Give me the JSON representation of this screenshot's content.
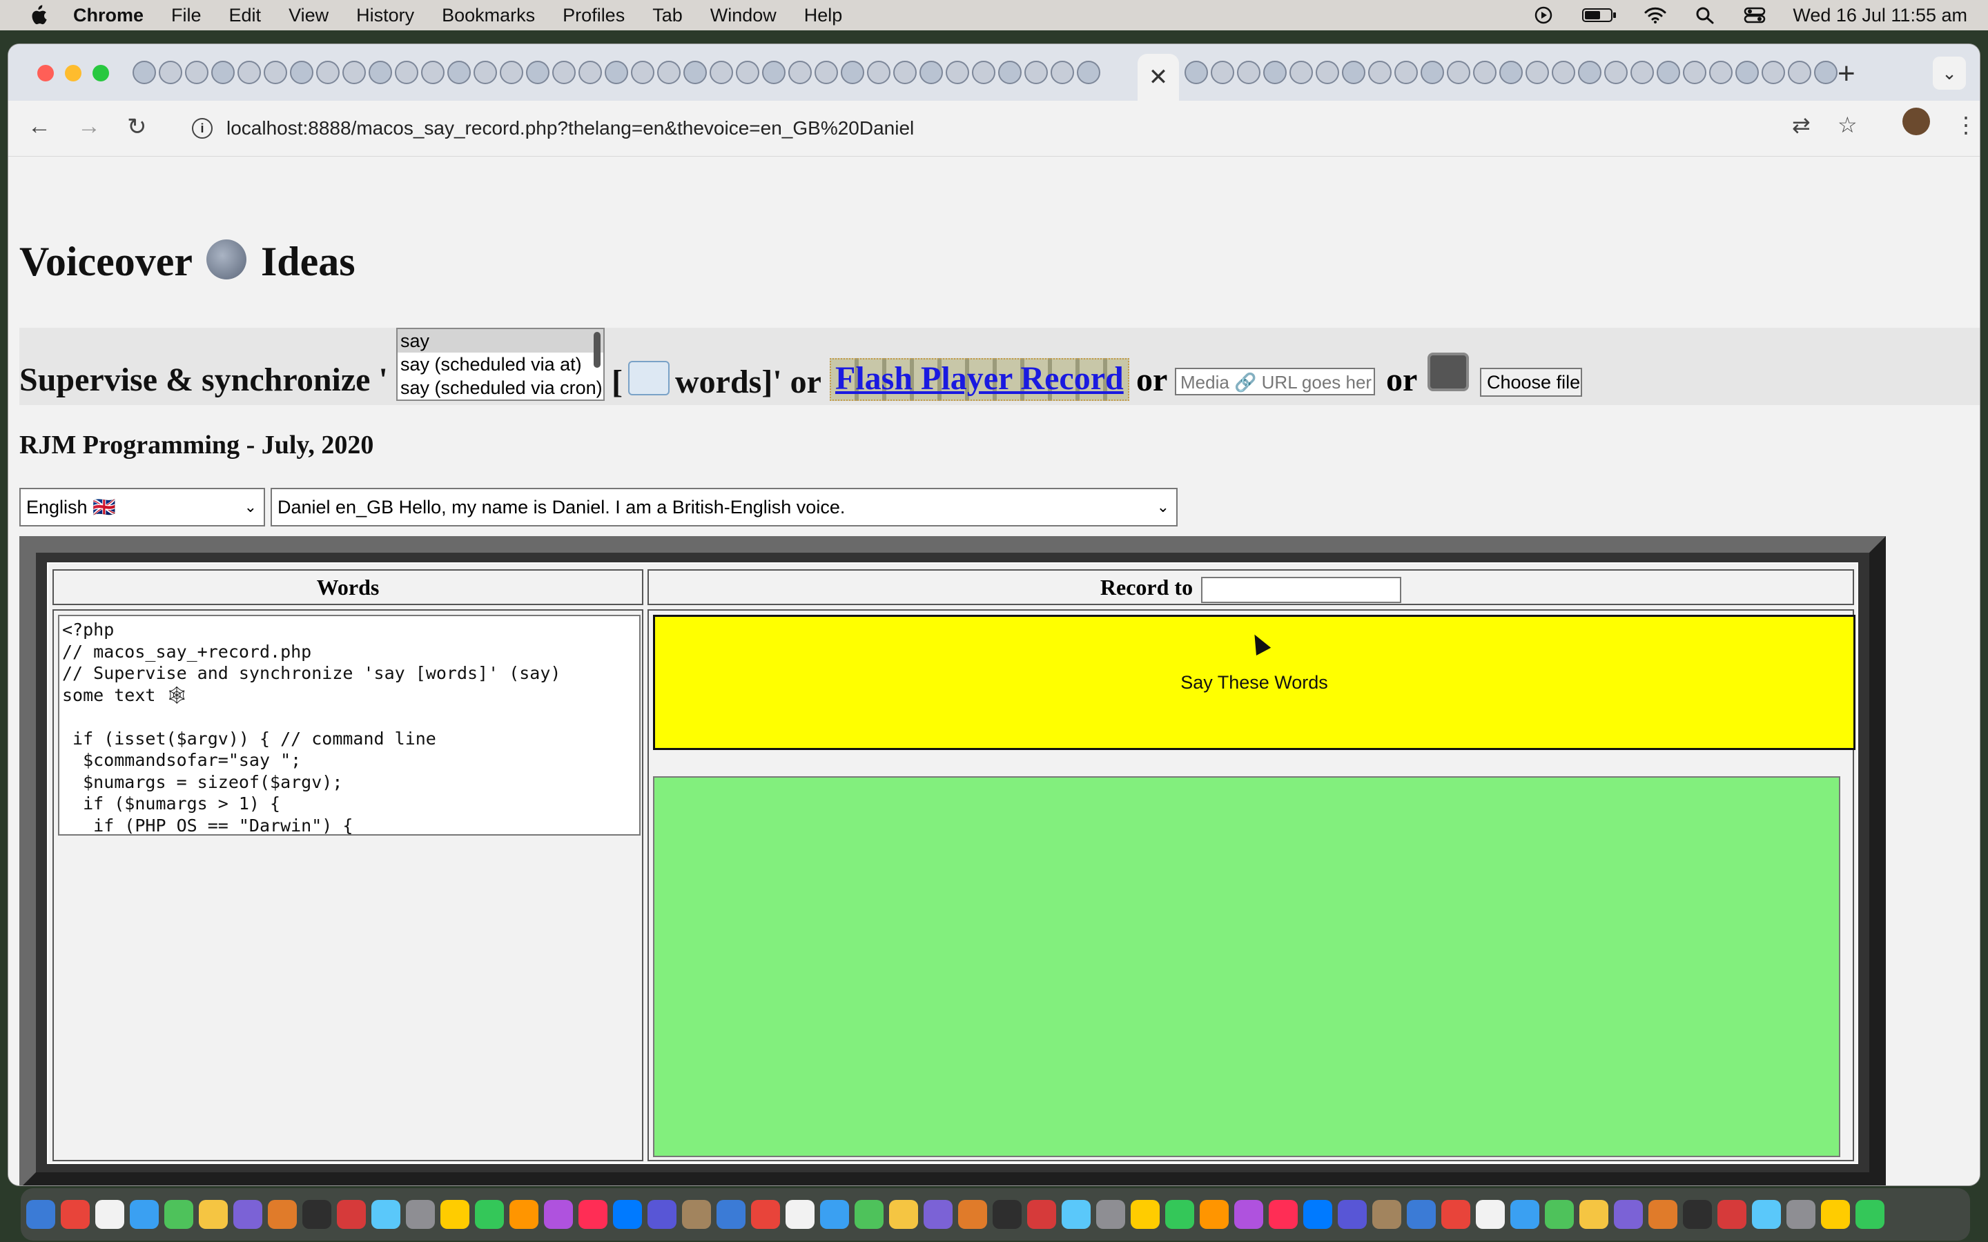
{
  "menubar": {
    "app_name": "Chrome",
    "items": [
      "File",
      "Edit",
      "View",
      "History",
      "Bookmarks",
      "Profiles",
      "Tab",
      "Window",
      "Help"
    ],
    "clock": "Wed 16 Jul  11:55 am",
    "icons": [
      "apple-logo",
      "screen-record-icon",
      "battery-icon",
      "wifi-icon",
      "spotlight-search-icon",
      "control-center-icon"
    ]
  },
  "browser": {
    "tab_close_glyph": "✕",
    "new_tab_glyph": "+",
    "tab_menu_glyph": "⌄",
    "url": "localhost:8888/macos_say_record.php?thelang=en&thevoice=en_GB%20Daniel",
    "info_glyph": "i",
    "back_glyph": "←",
    "forward_glyph": "→",
    "reload_glyph": "↻",
    "translate_glyph": "⇄",
    "bookmark_glyph": "☆",
    "menu_glyph": "⋮"
  },
  "page": {
    "title_pre": "Voiceover",
    "title_post": "Ideas",
    "supervise_text": "Supervise & synchronize '",
    "command_options": [
      "say",
      "say (scheduled via at)",
      "say (scheduled via cron)"
    ],
    "command_selected": "say",
    "words_text_open": "[",
    "words_text": "words]' or",
    "flash_link": "Flash Player Record",
    "or_1": "or",
    "media_placeholder": "Media 🔗 URL goes her",
    "or_2": "or",
    "choose_files": "Choose files",
    "byline": "RJM Programming - July, 2020",
    "language_select": "English 🇬🇧",
    "voice_select": "Daniel en_GB Hello, my name is Daniel. I am a British-English voice.",
    "words_header": "Words",
    "record_to_header": "Record to",
    "record_to_value": "",
    "code_text": "<?php\n// macos_say_+record.php\n// Supervise and synchronize 'say [words]' (say)\nsome text 🕸\n\n if (isset($argv)) { // command line\n  $commandsofar=\"say \";\n  $numargs = sizeof($argv);\n  if ($numargs > 1) {\n   if (PHP_OS == \"Darwin\") {",
    "say_button": "Say These Words"
  },
  "colors": {
    "say_button_bg": "#ffff00",
    "record_area_bg": "#82ef7d",
    "link_color": "#1a1ae0"
  }
}
